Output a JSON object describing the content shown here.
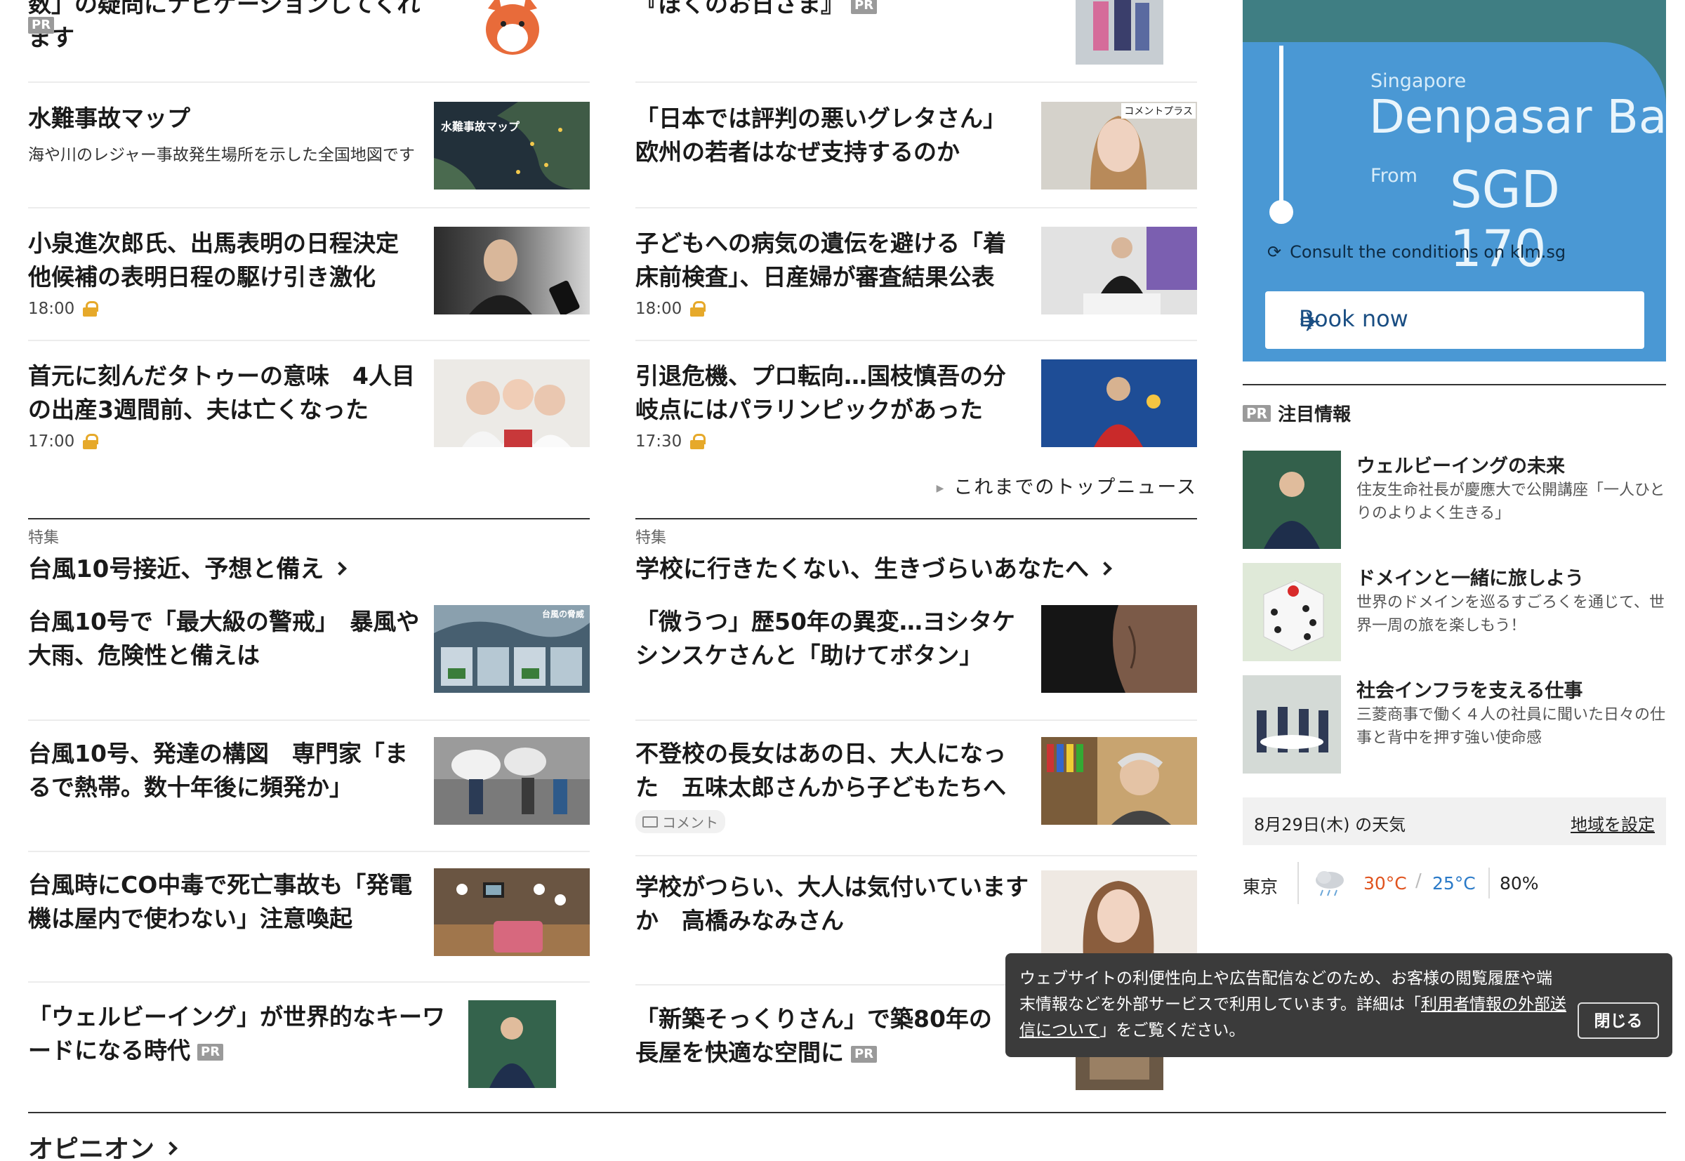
{
  "col1": {
    "top_item": {
      "title": "数」の疑問にナビゲーションしてくれます",
      "pr": "PR"
    },
    "items": [
      {
        "title": "水難事故マップ",
        "desc": "海や川のレジャー事故発生場所を示した全国地図です",
        "thumb_text": "水難事故マップ"
      },
      {
        "title": "小泉進次郎氏、出馬表明の日程決定　他候補の表明日程の駆け引き激化",
        "time": "18:00"
      },
      {
        "title": "首元に刻んだタトゥーの意味　4人目の出産3週間前、夫は亡くなった",
        "time": "17:00"
      }
    ],
    "section": {
      "label": "特集",
      "title": "台風10号接近、予想と備え",
      "items": [
        {
          "title": "台風10号で「最大級の警戒」　暴風や大雨、危険性と備えは",
          "thumb_text": "台風の脅威"
        },
        {
          "title": "台風10号、発達の構図　専門家「まるで熱帯。数十年後に頻発か」"
        },
        {
          "title": "台風時にCO中毒で死亡事故も「発電機は屋内で使わない」注意喚起"
        },
        {
          "title": "「ウェルビーイング」が世界的なキーワードになる時代",
          "pr": "PR"
        }
      ]
    }
  },
  "col2": {
    "top_item": {
      "title": "『ぼくのお日さま』",
      "pr": "PR"
    },
    "items": [
      {
        "title": "「日本では評判の悪いグレタさん」　欧州の若者はなぜ支持するのか",
        "badge": "コメントプラス"
      },
      {
        "title": "子どもへの病気の遺伝を避ける「着床前検査」、日産婦が審査結果公表",
        "time": "18:00"
      },
      {
        "title": "引退危機、プロ転向…国枝慎吾の分岐点にはパラリンピックがあった",
        "time": "17:30"
      }
    ],
    "more_link": "これまでのトップニュース",
    "section": {
      "label": "特集",
      "title": "学校に行きたくない、生きづらいあなたへ",
      "items": [
        {
          "title": "「微うつ」歴50年の異変…ヨシタケシンスケさんと「助けてボタン」"
        },
        {
          "title": "不登校の長女はあの日、大人になった　五味太郎さんから子どもたちへ",
          "comment": "コメント"
        },
        {
          "title": "学校がつらい、大人は気付いていますか　高橋みなみさん"
        },
        {
          "title": "「新築そっくりさん」で築80年の長屋を快適な空間に",
          "pr": "PR"
        }
      ]
    }
  },
  "ad": {
    "origin": "Singapore",
    "destination": "Denpasar Bali",
    "from_label": "From",
    "price": "SGD 170",
    "conditions": "Consult the conditions on klm.sg",
    "button": "Book now"
  },
  "side": {
    "pr_label": "PR",
    "heading": "注目情報",
    "items": [
      {
        "title": "ウェルビーイングの未来",
        "desc": "住友生命社長が慶應大で公開講座「一人ひとりのよりよく生きる」"
      },
      {
        "title": "ドメインと一緒に旅しよう",
        "desc": "世界のドメインを巡るすごろくを通じて、世界一周の旅を楽しもう！"
      },
      {
        "title": "社会インフラを支える仕事",
        "desc": "三菱商事で働く４人の社員に聞いた日々の仕事と背中を押す強い使命感"
      }
    ],
    "weather": {
      "date": "8月29日(木) の天気",
      "set_region": "地域を設定",
      "city": "東京",
      "high": "30°C",
      "low": "25°C",
      "humidity": "80%"
    }
  },
  "cookie": {
    "text_a": "ウェブサイトの利便性向上や広告配信などのため、お客様の閲覧履歴や端末情報などを外部サービスで利用しています。詳細は「",
    "link": "利用者情報の外部送信について",
    "text_b": "」をご覧ください。",
    "close": "閉じる"
  },
  "opinion": {
    "title": "オピニオン"
  },
  "colors": {
    "accent_blue": "#4a98d4",
    "lock": "#e6a92a",
    "temp_high": "#e0531e",
    "temp_low": "#2a7ac8"
  }
}
